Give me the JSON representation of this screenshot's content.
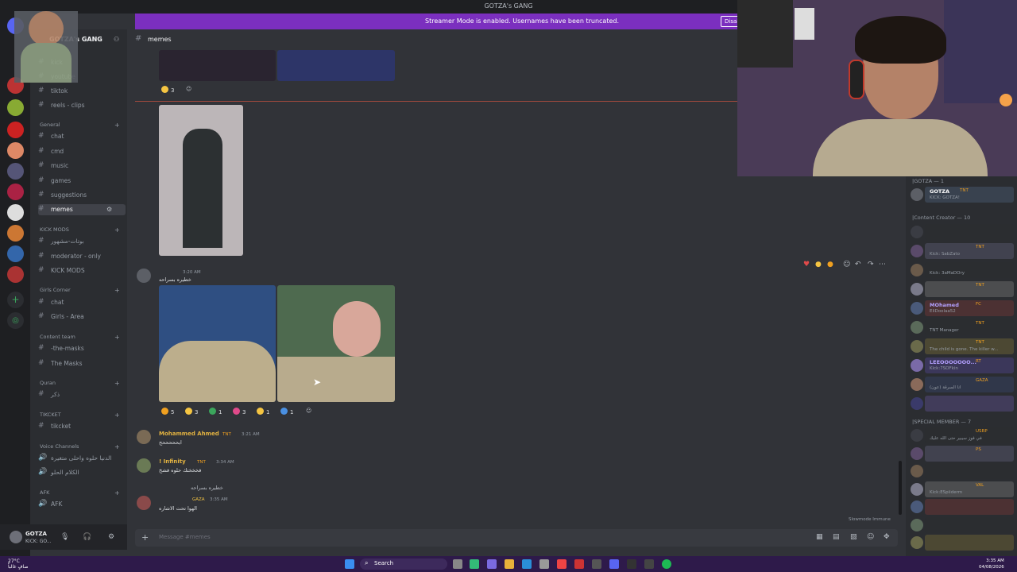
{
  "window": {
    "title": "GOTZA's GANG"
  },
  "banner": {
    "message": "Streamer Mode is enabled. Usernames have been truncated.",
    "disable_label": "Disable"
  },
  "server": {
    "name": "GOTZA's GANG"
  },
  "sidebar": {
    "top_channels": [
      {
        "name": "kick"
      },
      {
        "name": "youtube"
      },
      {
        "name": "tiktok"
      },
      {
        "name": "reels - clips"
      }
    ],
    "categories": [
      {
        "label": "General",
        "channels": [
          "chat",
          "cmd",
          "music",
          "games",
          "suggestions",
          "memes"
        ]
      },
      {
        "label": "KICK MODS",
        "channels": [
          "بوتات-مشهور",
          "moderator - only",
          "KICK MODS"
        ]
      },
      {
        "label": "Girls Corner",
        "channels": [
          "chat",
          "Girls - Area"
        ]
      },
      {
        "label": "Content team",
        "channels": [
          "-the-masks",
          "The Masks"
        ]
      },
      {
        "label": "Quran",
        "channels": [
          "ذكر"
        ]
      },
      {
        "label": "TIKCKET",
        "channels": [
          "tikcket"
        ]
      },
      {
        "label": "Voice Channels",
        "channels": [
          "الدنيا حلوه واحلى متغيرة",
          "الكلام الحلو"
        ]
      },
      {
        "label": "AFK",
        "channels": [
          "AFK"
        ]
      }
    ]
  },
  "user_panel": {
    "name": "GOTZA",
    "status": "KICK: GO..."
  },
  "channel_header": {
    "name": "memes"
  },
  "messages": {
    "reactions_top": [
      {
        "count": "3"
      }
    ],
    "msg1": {
      "author": "",
      "time": "3:20 AM",
      "text": "خطيره بسراحه"
    },
    "reactions_mid": [
      {
        "count": "5",
        "color": "#f0a020"
      },
      {
        "count": "3",
        "color": "#f5c542"
      },
      {
        "count": "1",
        "color": "#3ba55c"
      },
      {
        "count": "3",
        "color": "#e04a8a"
      },
      {
        "count": "1",
        "color": "#f5c542"
      },
      {
        "count": "1",
        "color": "#4a90e2"
      }
    ],
    "msg2": {
      "author": "Mohammed Ahmed",
      "role": "TNT",
      "time": "3:21 AM",
      "text": "ابحححححح"
    },
    "msg3": {
      "author": "! Infinity",
      "role": "TNT",
      "time": "3:34 AM",
      "text": "فخخختك حلوه فشخ"
    },
    "msg4": {
      "reply": "خطيره بسراحه",
      "role": "GAZA",
      "time": "3:35 AM",
      "text": "الهوا تحت الاشاره"
    }
  },
  "composer": {
    "placeholder": "Message #memes"
  },
  "immune": "Slowmode Immune",
  "members": {
    "groups": [
      {
        "label": "|GOTZA — 1"
      },
      {
        "label": "|Content Creator — 10"
      },
      {
        "label": "|SPECIAL MEMBER — 7"
      }
    ],
    "gotza": {
      "name": "GOTZA",
      "tag": "TNT",
      "status": "KICK: GOTZA!"
    },
    "cc": [
      {
        "name": "",
        "tag": "",
        "status": ""
      },
      {
        "name": "",
        "tag": "TNT",
        "status": "Kick: SabZato"
      },
      {
        "name": "",
        "tag": "",
        "status": "Kick: 3aMaDOry"
      },
      {
        "name": "",
        "tag": "TNT",
        "status": ""
      },
      {
        "name": "MOhamed",
        "tag": "FC",
        "status": "EliDoolaa52"
      },
      {
        "name": "",
        "tag": "TNT",
        "status": "TNT Manager"
      },
      {
        "name": "",
        "tag": "TNT",
        "status": "The child is gone. The killer w..."
      },
      {
        "name": "LEEOOOOOOO...",
        "tag": "RT",
        "status": "Kick:7SOFkin"
      },
      {
        "name": "",
        "tag": "GAZA",
        "status": "انا السرقة (عون)"
      },
      {
        "name": "",
        "tag": "",
        "status": ""
      }
    ],
    "special": [
      {
        "name": "",
        "tag": "USRP",
        "status": "في فوز سيبير حتى الله عليك"
      },
      {
        "name": "",
        "tag": "PS",
        "status": ""
      },
      {
        "name": "",
        "tag": "",
        "status": ""
      },
      {
        "name": "",
        "tag": "VAL",
        "status": "Kick:ESpiiderm"
      },
      {
        "name": "",
        "tag": "",
        "status": ""
      },
      {
        "name": "",
        "tag": "",
        "status": ""
      },
      {
        "name": "",
        "tag": "",
        "status": ""
      }
    ]
  },
  "taskbar": {
    "weather_temp": "27°C",
    "weather_desc": "صافٍ غالباً",
    "search_label": "Search",
    "time": "3:35 AM",
    "date": "04/08/2026"
  },
  "colors": {
    "accent": "#7b2fbf",
    "tnt": "#f0a020",
    "author_gold": "#e3b341"
  }
}
